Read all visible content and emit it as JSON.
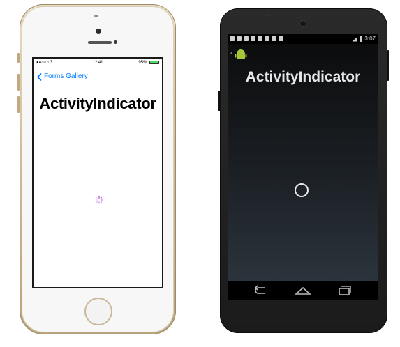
{
  "ios": {
    "status": {
      "carrier": "●●○○○ 3 ",
      "time": "12:41",
      "battery": "95%"
    },
    "nav": {
      "back_label": "Forms Gallery"
    },
    "page_title": "ActivityIndicator",
    "accent_color": "#007aff"
  },
  "android": {
    "status": {
      "time": "3:07"
    },
    "page_title": "ActivityIndicator",
    "nav_buttons": [
      "back-icon",
      "home-icon",
      "recent-apps-icon"
    ]
  }
}
